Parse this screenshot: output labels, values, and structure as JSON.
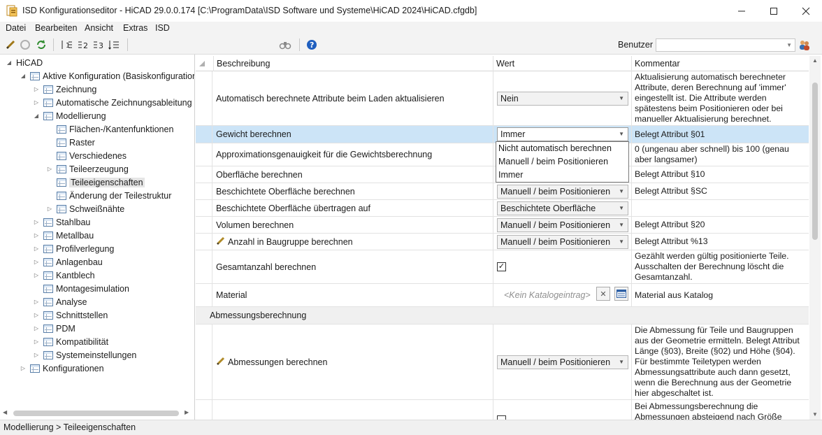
{
  "window": {
    "title": "ISD Konfigurationseditor  -  HiCAD 29.0.0.174 [C:\\ProgramData\\ISD Software und Systeme\\HiCAD 2024\\HiCAD.cfgdb]"
  },
  "menu": [
    "Datei",
    "Bearbeiten",
    "Ansicht",
    "Extras",
    "ISD"
  ],
  "toolbar": {
    "benutzer_label": "Benutzer",
    "benutzer_value": ""
  },
  "tree": [
    {
      "label": "HiCAD",
      "level": 0,
      "expander": "open"
    },
    {
      "label": "Aktive Konfiguration (Basiskonfiguration)",
      "level": 1,
      "expander": "open"
    },
    {
      "label": "Zeichnung",
      "level": 2,
      "expander": "closed"
    },
    {
      "label": "Automatische Zeichnungsableitung",
      "level": 2,
      "expander": "closed"
    },
    {
      "label": "Modellierung",
      "level": 2,
      "expander": "open"
    },
    {
      "label": "Flächen-/Kantenfunktionen",
      "level": 3,
      "expander": "none"
    },
    {
      "label": "Raster",
      "level": 3,
      "expander": "none"
    },
    {
      "label": "Verschiedenes",
      "level": 3,
      "expander": "none"
    },
    {
      "label": "Teileerzeugung",
      "level": 3,
      "expander": "closed"
    },
    {
      "label": "Teileeigenschaften",
      "level": 3,
      "expander": "none",
      "selected": true
    },
    {
      "label": "Änderung der Teilestruktur",
      "level": 3,
      "expander": "none"
    },
    {
      "label": "Schweißnähte",
      "level": 3,
      "expander": "closed"
    },
    {
      "label": "Stahlbau",
      "level": 2,
      "expander": "closed"
    },
    {
      "label": "Metallbau",
      "level": 2,
      "expander": "closed"
    },
    {
      "label": "Profilverlegung",
      "level": 2,
      "expander": "closed"
    },
    {
      "label": "Anlagenbau",
      "level": 2,
      "expander": "closed"
    },
    {
      "label": "Kantblech",
      "level": 2,
      "expander": "closed"
    },
    {
      "label": "Montagesimulation",
      "level": 2,
      "expander": "none"
    },
    {
      "label": "Analyse",
      "level": 2,
      "expander": "closed"
    },
    {
      "label": "Schnittstellen",
      "level": 2,
      "expander": "closed"
    },
    {
      "label": "PDM",
      "level": 2,
      "expander": "closed"
    },
    {
      "label": "Kompatibilität",
      "level": 2,
      "expander": "closed"
    },
    {
      "label": "Systemeinstellungen",
      "level": 2,
      "expander": "closed"
    },
    {
      "label": "Konfigurationen",
      "level": 1,
      "expander": "closed"
    }
  ],
  "grid": {
    "columns": [
      "Beschreibung",
      "Wert",
      "Kommentar"
    ],
    "rows": [
      {
        "desc": "Automatisch berechnete Attribute beim Laden aktualisieren",
        "value": "Nein",
        "type": "combo",
        "comment": "Aktualisierung automatisch berechneter Attribute, deren Berechnung auf 'immer' eingestellt ist. Die Attribute werden spätestens beim Positionieren oder bei manueller Aktualisierung berechnet."
      },
      {
        "desc": "Gewicht berechnen",
        "value": "Immer",
        "type": "combo-open",
        "comment": "Belegt Attribut §01",
        "selected": true
      },
      {
        "desc": "Approximationsgenauigkeit für die Gewichtsberechnung",
        "value": "",
        "type": "none",
        "comment": "0 (ungenau aber schnell) bis 100 (genau aber langsamer)"
      },
      {
        "desc": "Oberfläche berechnen",
        "value": "",
        "type": "none",
        "comment": "Belegt Attribut §10"
      },
      {
        "desc": "Beschichtete Oberfläche berechnen",
        "value": "Manuell / beim Positionieren",
        "type": "combo",
        "comment": "Belegt Attribut §SC"
      },
      {
        "desc": "Beschichtete Oberfläche übertragen auf",
        "value": "Beschichtete Oberfläche",
        "type": "combo",
        "comment": ""
      },
      {
        "desc": "Volumen berechnen",
        "value": "Manuell / beim Positionieren",
        "type": "combo",
        "comment": "Belegt Attribut §20"
      },
      {
        "desc": "Anzahl in Baugruppe berechnen",
        "value": "Manuell / beim Positionieren",
        "type": "combo",
        "comment": "Belegt Attribut %13",
        "pencil": true
      },
      {
        "desc": "Gesamtanzahl berechnen",
        "value": "✓",
        "type": "check",
        "comment": "Gezählt werden gültig positionierte Teile. Ausschalten der Berechnung löscht die Gesamtanzahl."
      },
      {
        "desc": "Material",
        "value": "<Kein Katalogeintrag>",
        "type": "catalog",
        "comment": "Material aus Katalog"
      },
      {
        "group": "Abmessungsberechnung"
      },
      {
        "desc": "Abmessungen berechnen",
        "value": "Manuell / beim Positionieren",
        "type": "combo",
        "comment": "Die Abmessung für Teile und Baugruppen aus der Geometrie ermitteln. Belegt Attribut Länge (§03), Breite (§02) und Höhe (§04). Für bestimmte Teiletypen werden Abmessungsattribute auch dann gesetzt, wenn die Berechnung aus der Geometrie hier abgeschaltet ist.",
        "pencil": true
      },
      {
        "desc": "",
        "value": "",
        "type": "check-partial",
        "comment": "Bei Abmessungsberechnung die Abmessungen absteigend nach Größe sortiert"
      }
    ]
  },
  "dropdown": {
    "options": [
      "Nicht automatisch berechnen",
      "Manuell / beim Positionieren",
      "Immer"
    ]
  },
  "status": {
    "text": "Modellierung > Teileeigenschaften"
  },
  "colors": {
    "selection": "#cce4f7",
    "group_bg": "#f0f0f0",
    "chrome": "#f3f3f3"
  }
}
